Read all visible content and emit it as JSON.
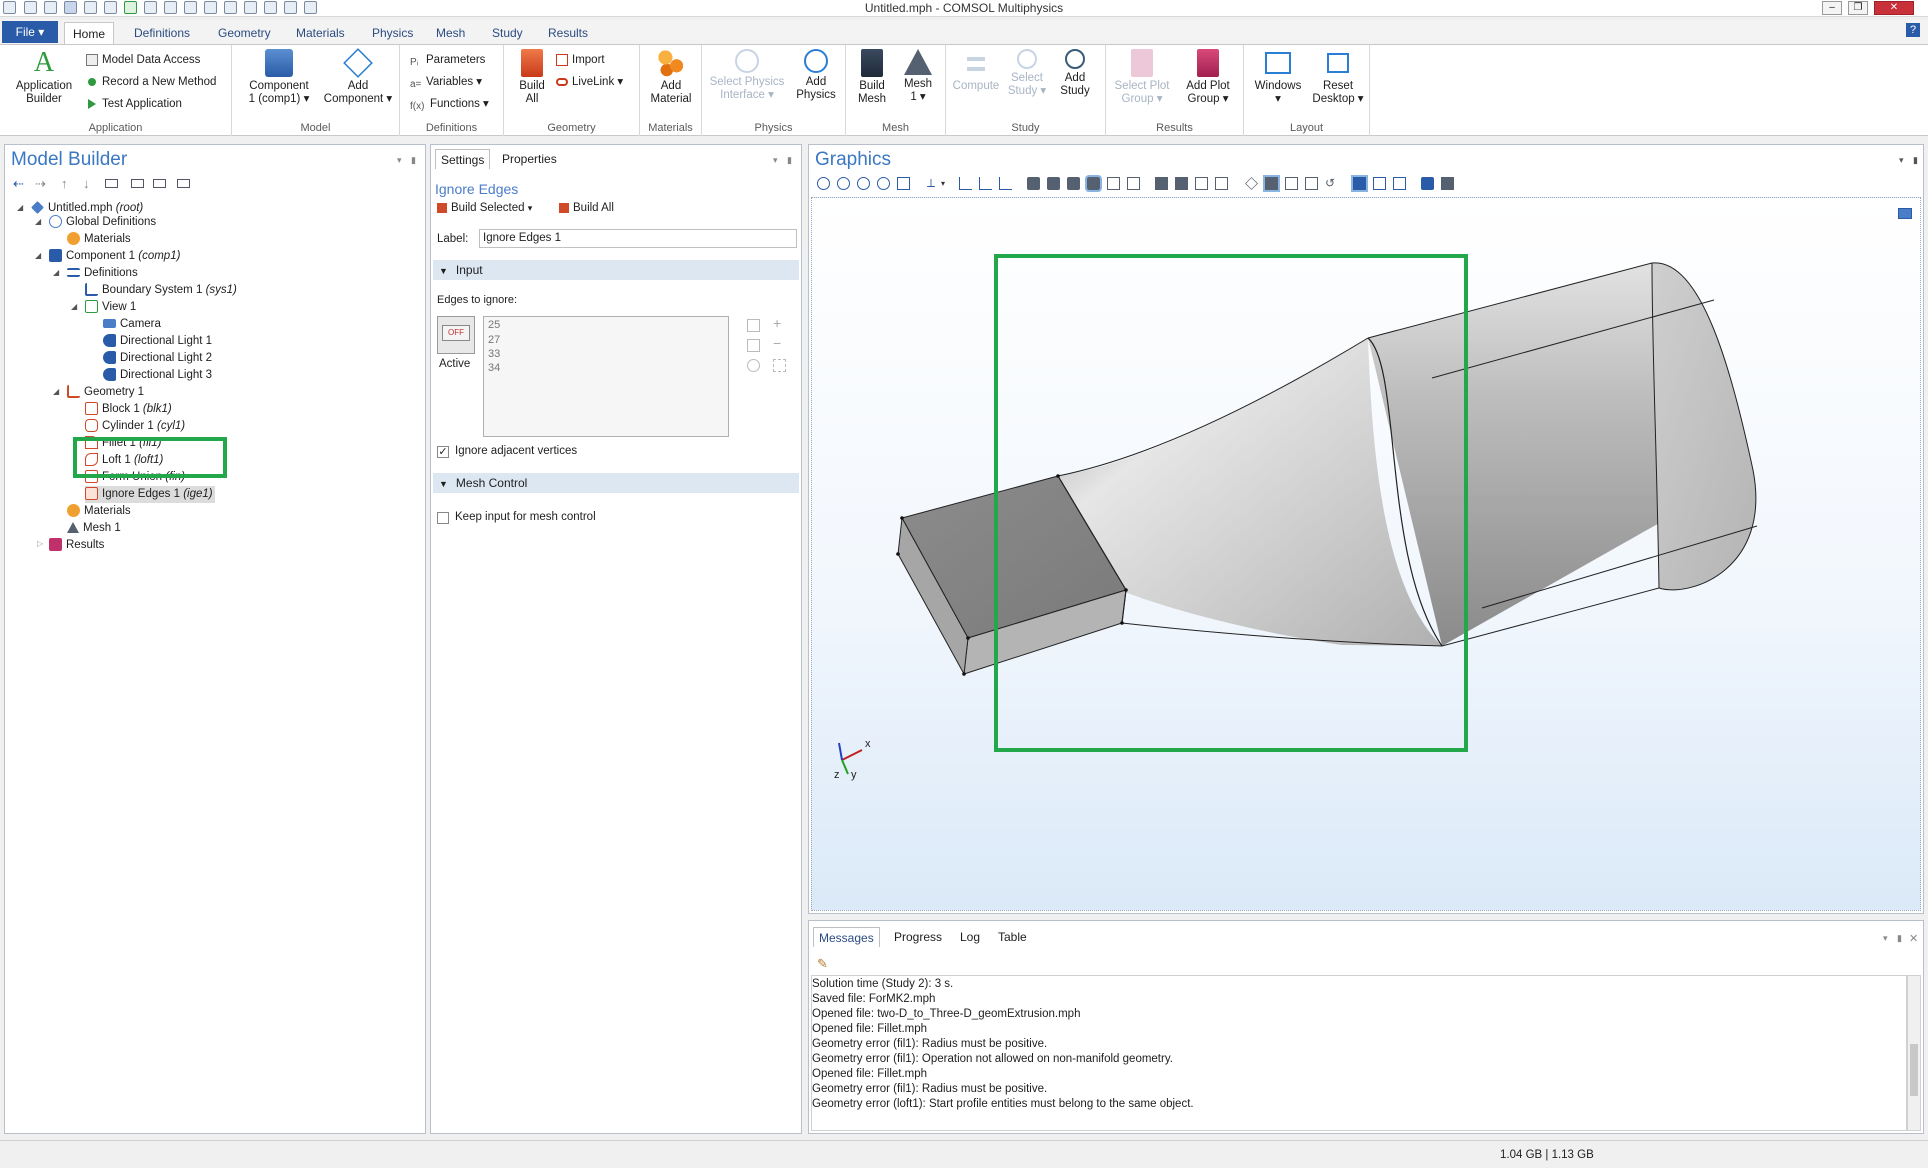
{
  "window": {
    "title": "Untitled.mph - COMSOL Multiphysics"
  },
  "ribbon_tabs": [
    "Home",
    "Definitions",
    "Geometry",
    "Materials",
    "Physics",
    "Mesh",
    "Study",
    "Results"
  ],
  "file_label": "File ▾",
  "help_label": "?",
  "ribbon": {
    "application": {
      "group": "Application",
      "builder_label1": "Application",
      "builder_label2": "Builder",
      "model_data_access": "Model Data Access",
      "record_method": "Record a New Method",
      "test_application": "Test Application"
    },
    "model": {
      "group": "Model",
      "component_label1": "Component",
      "component_label2": "1 (comp1) ▾",
      "add_component1": "Add",
      "add_component2": "Component ▾"
    },
    "definitions": {
      "group": "Definitions",
      "parameters": "Parameters",
      "variables": "Variables ▾",
      "functions": "Functions ▾"
    },
    "geometry": {
      "group": "Geometry",
      "build_all1": "Build",
      "build_all2": "All",
      "import": "Import",
      "livelink": "LiveLink ▾"
    },
    "materials": {
      "group": "Materials",
      "add_material1": "Add",
      "add_material2": "Material"
    },
    "physics": {
      "group": "Physics",
      "select_physics1": "Select Physics",
      "select_physics2": "Interface ▾",
      "add_physics1": "Add",
      "add_physics2": "Physics"
    },
    "mesh": {
      "group": "Mesh",
      "build_mesh1": "Build",
      "build_mesh2": "Mesh",
      "mesh1": "Mesh",
      "mesh2": "1 ▾"
    },
    "study": {
      "group": "Study",
      "compute": "Compute",
      "select_study1": "Select",
      "select_study2": "Study ▾",
      "add_study1": "Add",
      "add_study2": "Study"
    },
    "results": {
      "group": "Results",
      "select_plot1": "Select Plot",
      "select_plot2": "Group ▾",
      "add_plot1": "Add Plot",
      "add_plot2": "Group ▾"
    },
    "layout": {
      "group": "Layout",
      "windows1": "Windows",
      "windows2": "▾",
      "reset1": "Reset",
      "reset2": "Desktop ▾"
    }
  },
  "model_builder": {
    "title": "Model Builder",
    "tree": [
      {
        "label": "Untitled.mph",
        "tag": "(root)"
      },
      {
        "label": "Global Definitions",
        "tag": ""
      },
      {
        "label": "Materials",
        "tag": ""
      },
      {
        "label": "Component 1",
        "tag": "(comp1)"
      },
      {
        "label": "Definitions",
        "tag": ""
      },
      {
        "label": "Boundary System 1",
        "tag": "(sys1)"
      },
      {
        "label": "View 1",
        "tag": ""
      },
      {
        "label": "Camera",
        "tag": ""
      },
      {
        "label": "Directional Light 1",
        "tag": ""
      },
      {
        "label": "Directional Light 2",
        "tag": ""
      },
      {
        "label": "Directional Light 3",
        "tag": ""
      },
      {
        "label": "Geometry 1",
        "tag": ""
      },
      {
        "label": "Block 1",
        "tag": "(blk1)"
      },
      {
        "label": "Cylinder 1",
        "tag": "(cyl1)"
      },
      {
        "label": "Fillet 1",
        "tag": "(fil1)"
      },
      {
        "label": "Loft 1",
        "tag": "(loft1)"
      },
      {
        "label": "Form Union",
        "tag": "(fin)"
      },
      {
        "label": "Ignore Edges 1",
        "tag": "(ige1)"
      },
      {
        "label": "Materials",
        "tag": ""
      },
      {
        "label": "Mesh 1",
        "tag": ""
      },
      {
        "label": "Results",
        "tag": ""
      }
    ]
  },
  "settings": {
    "tab_settings": "Settings",
    "tab_properties": "Properties",
    "heading": "Ignore Edges",
    "build_selected": "Build Selected",
    "build_all": "Build All",
    "label_caption": "Label:",
    "label_value": "Ignore Edges 1",
    "input_section": "Input",
    "edges_caption": "Edges to ignore:",
    "edges": [
      "25",
      "27",
      "33",
      "34"
    ],
    "toggle_text": "OFF",
    "active_label": "Active",
    "ignore_vertices": "Ignore adjacent vertices",
    "mesh_control_section": "Mesh Control",
    "keep_input": "Keep input for mesh control"
  },
  "graphics": {
    "title": "Graphics",
    "axis_x": "x",
    "axis_y": "y",
    "axis_z": "z"
  },
  "messages": {
    "tabs": [
      "Messages",
      "Progress",
      "Log",
      "Table"
    ],
    "lines": [
      "Solution time (Study 2): 3 s.",
      "Saved file: ForMK2.mph",
      "Opened file: two-D_to_Three-D_geomExtrusion.mph",
      "Opened file: Fillet.mph",
      "Geometry error (fil1): Radius must be positive.",
      "Geometry error (fil1): Operation not allowed on non-manifold geometry.",
      "Opened file: Fillet.mph",
      "Geometry error (fil1): Radius must be positive.",
      "Geometry error (loft1): Start profile entities must belong to the same object."
    ]
  },
  "status": {
    "memory": "1.04 GB | 1.13 GB"
  },
  "colors": {
    "accent": "#3a78c2",
    "file_button": "#2a5ba8",
    "highlight_box": "#22a84a"
  }
}
